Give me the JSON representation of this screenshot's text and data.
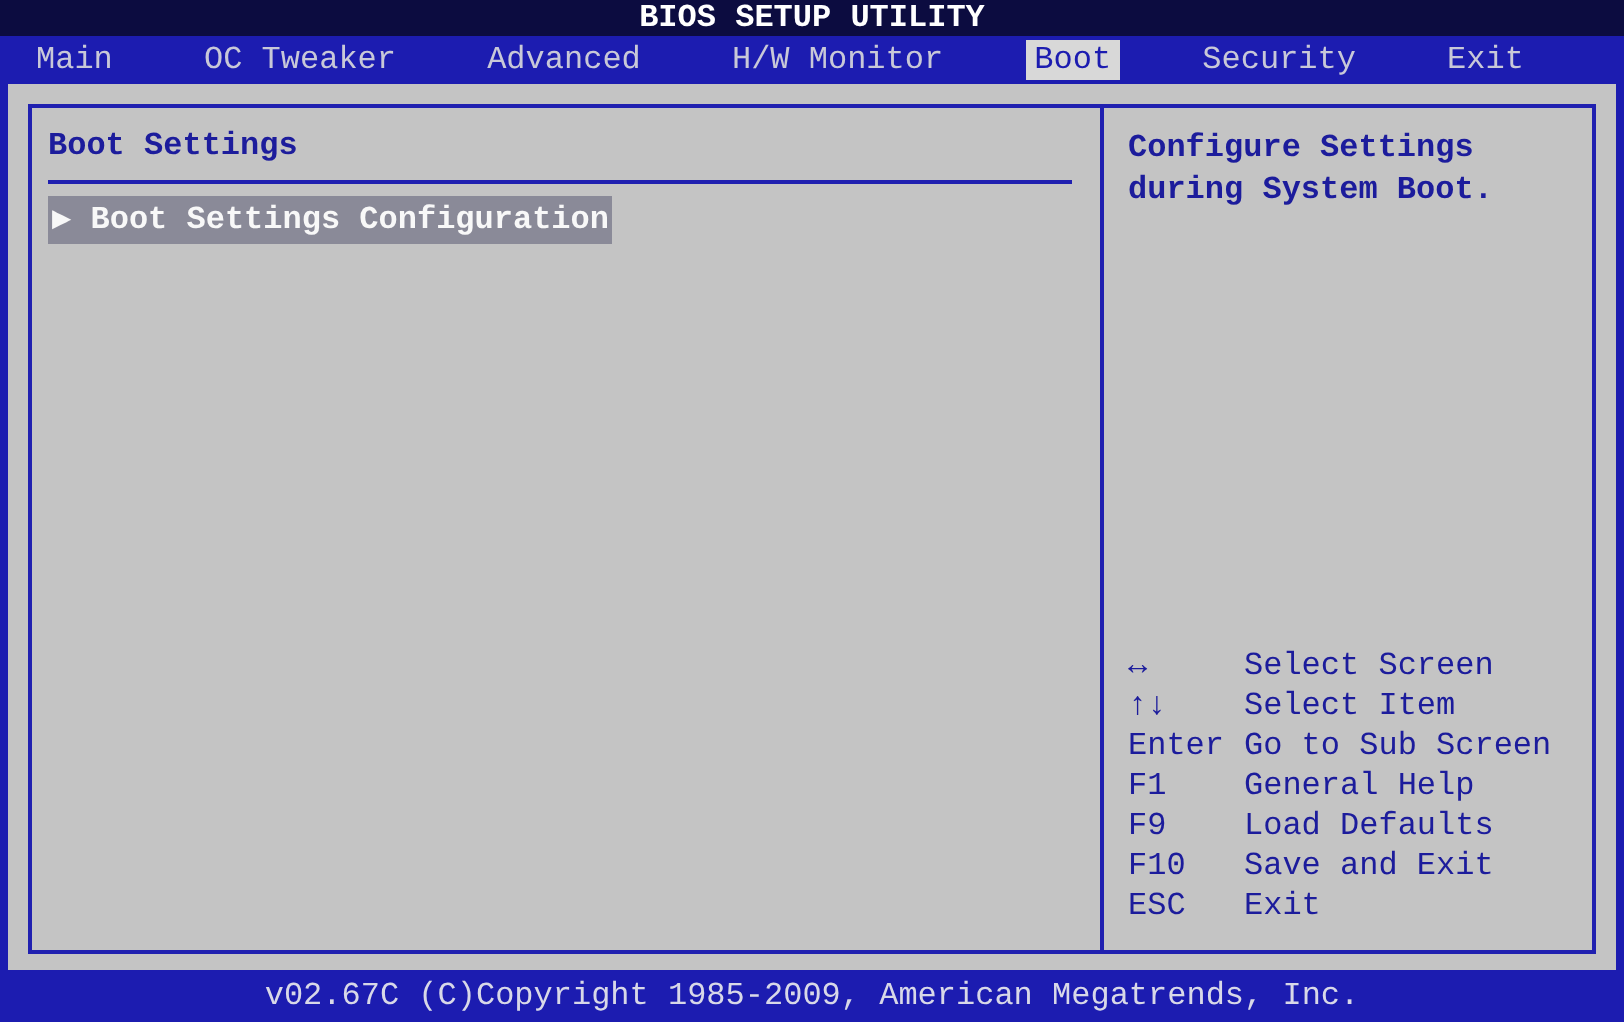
{
  "window": {
    "title": "BIOS SETUP UTILITY"
  },
  "tabs": [
    {
      "label": "Main",
      "selected": false
    },
    {
      "label": "OC Tweaker",
      "selected": false
    },
    {
      "label": "Advanced",
      "selected": false
    },
    {
      "label": "H/W Monitor",
      "selected": false
    },
    {
      "label": "Boot",
      "selected": true
    },
    {
      "label": "Security",
      "selected": false
    },
    {
      "label": "Exit",
      "selected": false
    }
  ],
  "panel": {
    "title": "Boot Settings",
    "items": [
      {
        "marker": "▶",
        "label": "Boot Settings Configuration",
        "selected": true
      }
    ]
  },
  "help": {
    "text": "Configure Settings during System Boot.",
    "keys": [
      {
        "key": "↔",
        "action": "Select Screen"
      },
      {
        "key": "↑↓",
        "action": "Select Item"
      },
      {
        "key": "Enter",
        "action": "Go to Sub Screen"
      },
      {
        "key": "F1",
        "action": "General Help"
      },
      {
        "key": "F9",
        "action": "Load Defaults"
      },
      {
        "key": "F10",
        "action": "Save and Exit"
      },
      {
        "key": "ESC",
        "action": "Exit"
      }
    ]
  },
  "status_bar": "v02.67C (C)Copyright 1985-2009, American Megatrends, Inc."
}
